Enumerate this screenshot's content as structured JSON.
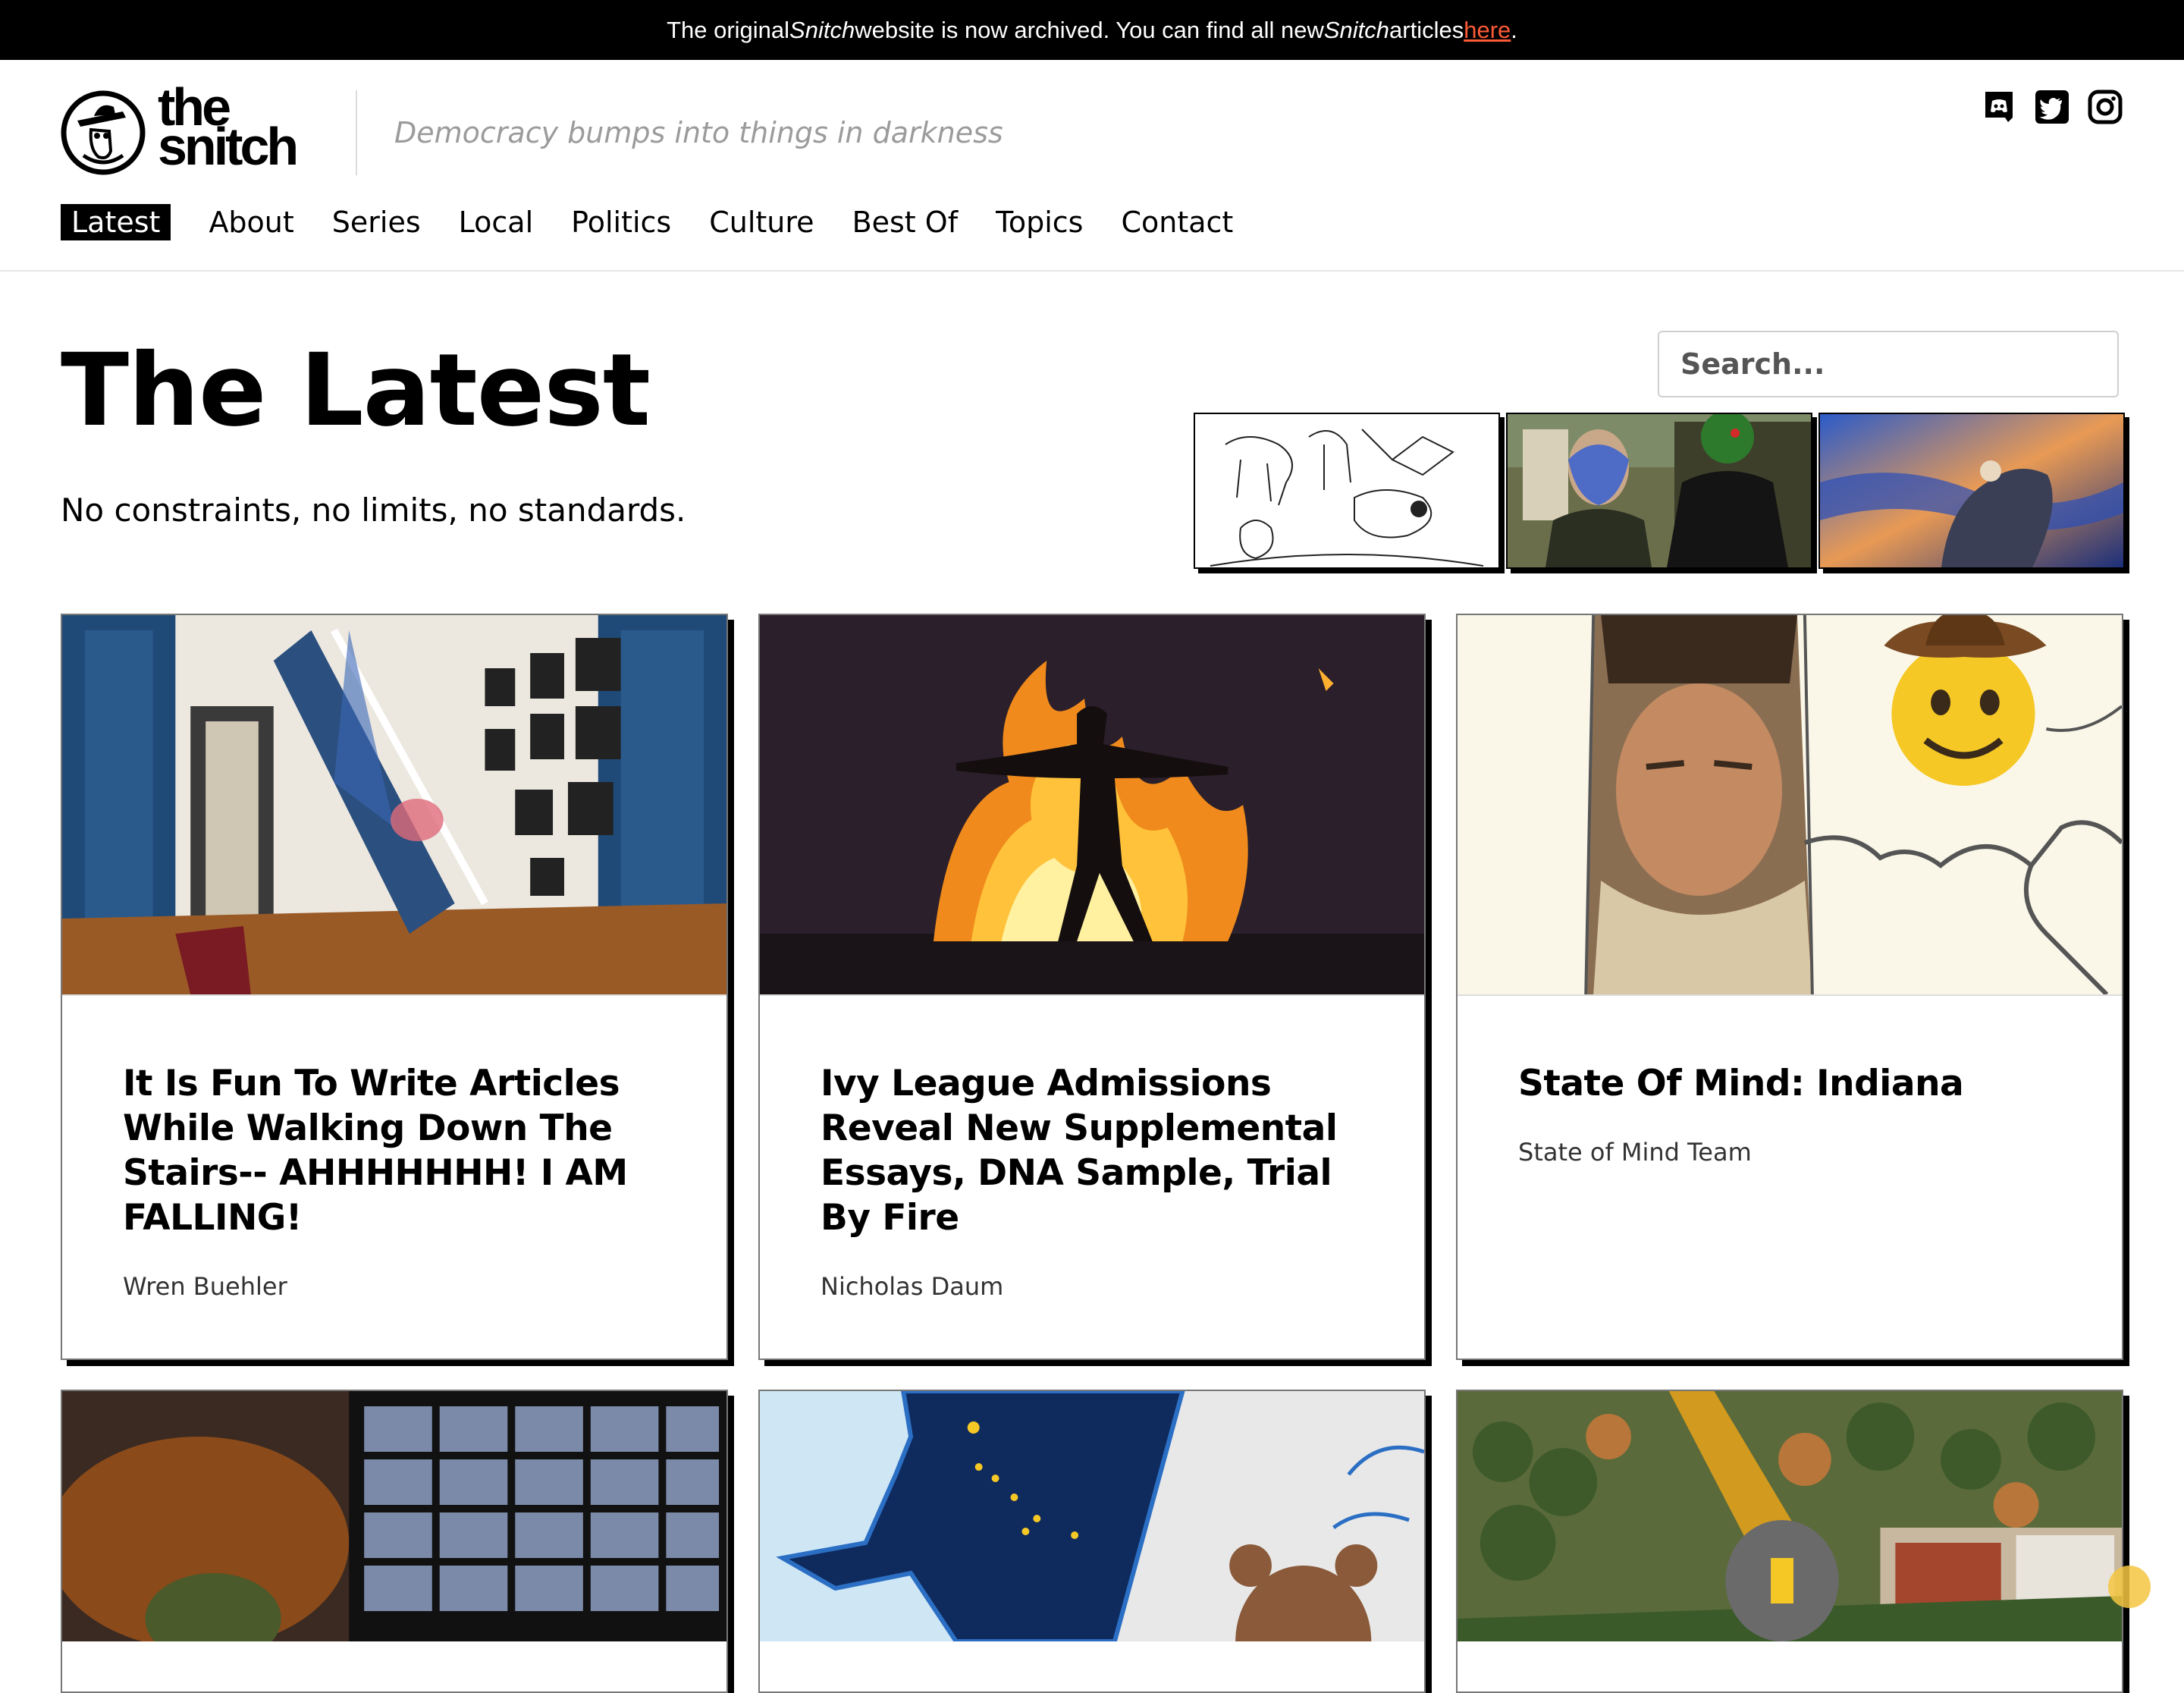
{
  "banner": {
    "prefix": "The original ",
    "brand1": "Snitch",
    "middle": " website is now archived. You can find all new ",
    "brand2": "Snitch",
    "suffix": " articles ",
    "link_text": "here",
    "end": "."
  },
  "header": {
    "logo_line1": "the",
    "logo_line2": "snitch",
    "tagline": "Democracy bumps into things in darkness",
    "social": [
      "discord-icon",
      "twitter-icon",
      "instagram-icon"
    ]
  },
  "nav": [
    "Latest",
    "About",
    "Series",
    "Local",
    "Politics",
    "Culture",
    "Best Of",
    "Topics",
    "Contact"
  ],
  "nav_active": "Latest",
  "hero": {
    "title": "The Latest",
    "subtitle": "No constraints, no limits, no standards.",
    "search_placeholder": "Search..."
  },
  "cards": [
    {
      "title": "It Is Fun To Write Articles While Walking Down The Stairs-- AHHHHHHH! I AM FALLING!",
      "author": "Wren Buehler"
    },
    {
      "title": "Ivy League Admissions Reveal New Supplemental Essays, DNA Sample, Trial By Fire",
      "author": "Nicholas Daum"
    },
    {
      "title": "State Of Mind: Indiana",
      "author": "State of Mind Team"
    }
  ],
  "colors": {
    "accent_link": "#ff5a36",
    "banner_bg": "#000000"
  }
}
